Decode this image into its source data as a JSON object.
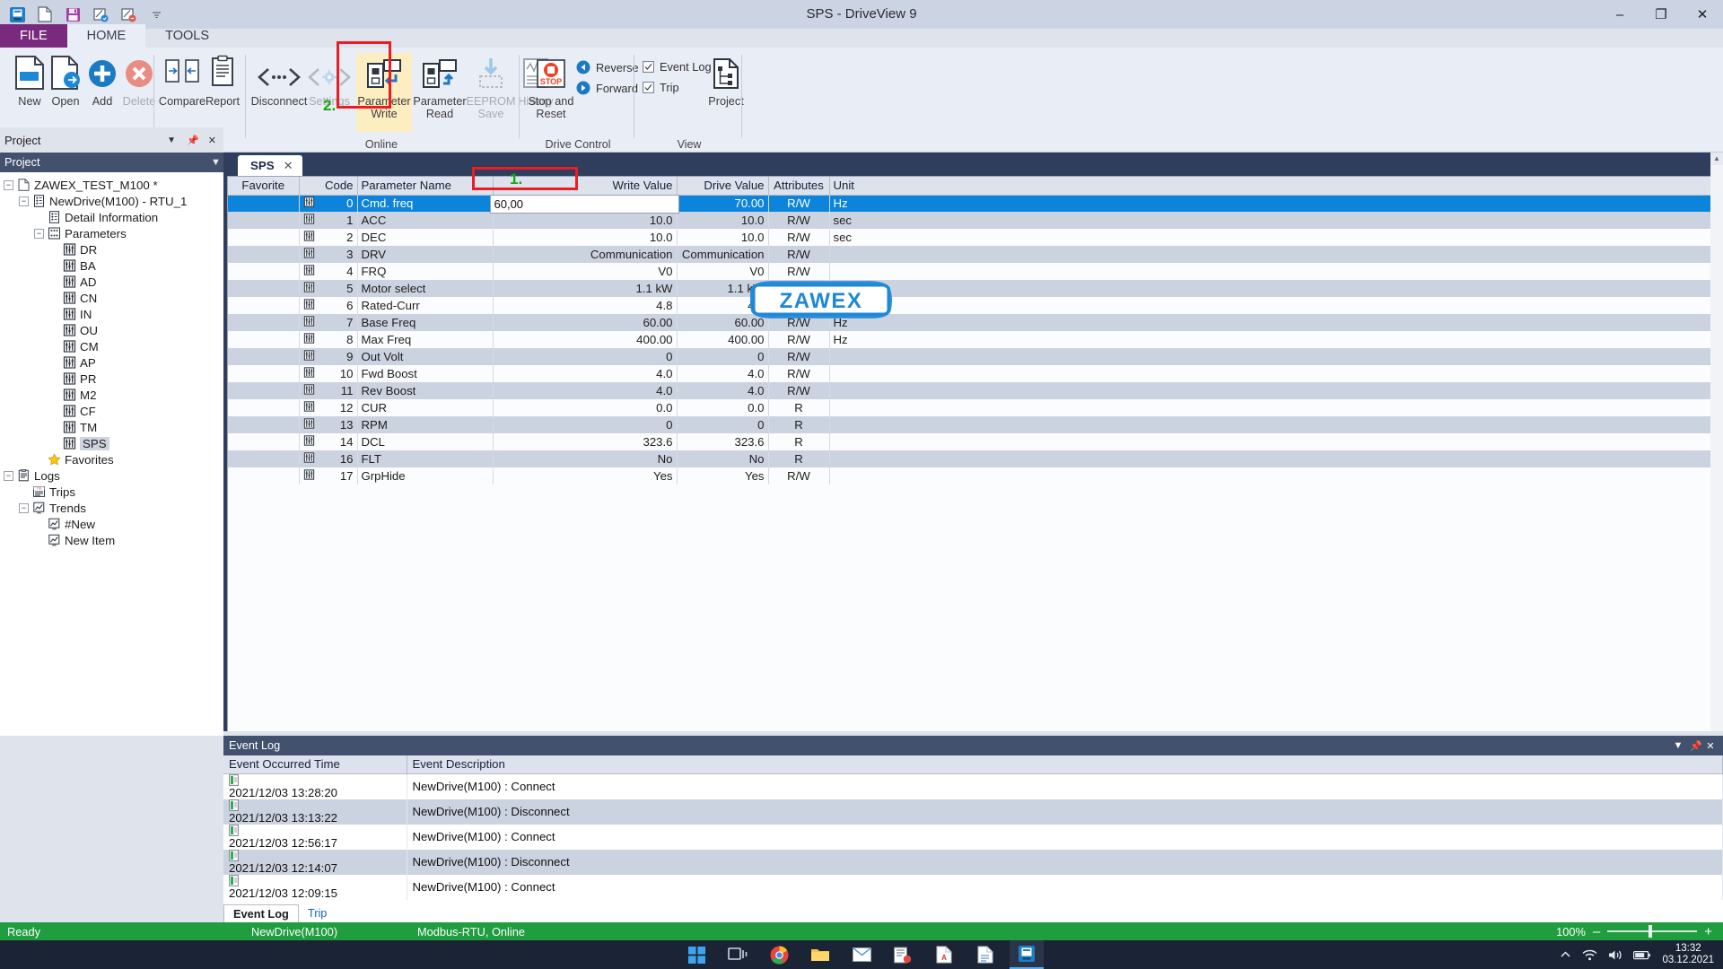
{
  "window": {
    "title": "SPS - DriveView 9",
    "minimize": "–",
    "maximize": "❐",
    "close": "✕"
  },
  "quick_access": [
    "app-icon",
    "new-icon",
    "save-icon",
    "param-write-icon",
    "param-read-icon",
    "more-icon"
  ],
  "tabs": [
    {
      "label": "FILE",
      "active": false
    },
    {
      "label": "HOME",
      "active": true
    },
    {
      "label": "TOOLS",
      "active": false
    }
  ],
  "ribbon": {
    "groups": [
      {
        "name": "Project",
        "label": "Project",
        "buttons": [
          {
            "label": "New",
            "disabled": false
          },
          {
            "label": "Open",
            "disabled": false
          },
          {
            "label": "Add",
            "disabled": false
          },
          {
            "label": "Delete",
            "disabled": true
          },
          {
            "label": "Compare",
            "disabled": false
          },
          {
            "label": "Report",
            "disabled": false
          }
        ]
      },
      {
        "name": "Online",
        "label": "Online",
        "buttons": [
          {
            "label": "Disconnect",
            "disabled": false
          },
          {
            "label": "Settings",
            "disabled": true
          },
          {
            "label": "Parameter\nWrite",
            "line1": "Parameter",
            "line2": "Write",
            "highlighted": true
          },
          {
            "label": "Parameter\nRead",
            "line1": "Parameter",
            "line2": "Read"
          },
          {
            "label": "EEPROM\nSave",
            "line1": "EEPROM",
            "line2": "Save",
            "disabled": true
          },
          {
            "label": "History",
            "disabled": true
          }
        ]
      },
      {
        "name": "Drive Control",
        "label": "Drive Control",
        "buttons": [
          {
            "label": "Stop and\nReset",
            "line1": "Stop and",
            "line2": "Reset"
          }
        ],
        "radios": [
          {
            "label": "Reverse",
            "selected": false
          },
          {
            "label": "Forward",
            "selected": false
          }
        ]
      },
      {
        "name": "View",
        "label": "View",
        "checkboxes": [
          {
            "label": "Event Log",
            "checked": true
          },
          {
            "label": "Trip",
            "checked": true
          }
        ],
        "buttons": [
          {
            "label": "Project"
          }
        ]
      }
    ]
  },
  "annotations": [
    {
      "id": "1",
      "text": "1.",
      "color": "#12a80f",
      "target": "write-value-cell"
    },
    {
      "id": "2",
      "text": "2.",
      "color": "#12a80f",
      "target": "parameter-write-button"
    }
  ],
  "watermark": {
    "text": "ZAWEX",
    "color": "#1e88d8"
  },
  "sidebar": {
    "title": "Project",
    "header": "Project",
    "pin_icon": "pin-icon",
    "close_icon": "close-icon",
    "collapse_icon": "chevron-down-icon",
    "tree": [
      {
        "label": "ZAWEX_TEST_M100 *",
        "depth": 0,
        "toggle": "-",
        "icon": "file-icon"
      },
      {
        "label": "NewDrive(M100) - RTU_1",
        "depth": 1,
        "toggle": "-",
        "icon": "drive-icon"
      },
      {
        "label": "Detail Information",
        "depth": 2,
        "toggle": "",
        "icon": "drive-icon"
      },
      {
        "label": "Parameters",
        "depth": 2,
        "toggle": "-",
        "icon": "params-icon"
      },
      {
        "label": "DR",
        "depth": 3,
        "toggle": "",
        "icon": "param-icon"
      },
      {
        "label": "BA",
        "depth": 3,
        "toggle": "",
        "icon": "param-icon"
      },
      {
        "label": "AD",
        "depth": 3,
        "toggle": "",
        "icon": "param-icon"
      },
      {
        "label": "CN",
        "depth": 3,
        "toggle": "",
        "icon": "param-icon"
      },
      {
        "label": "IN",
        "depth": 3,
        "toggle": "",
        "icon": "param-icon"
      },
      {
        "label": "OU",
        "depth": 3,
        "toggle": "",
        "icon": "param-icon"
      },
      {
        "label": "CM",
        "depth": 3,
        "toggle": "",
        "icon": "param-icon"
      },
      {
        "label": "AP",
        "depth": 3,
        "toggle": "",
        "icon": "param-icon"
      },
      {
        "label": "PR",
        "depth": 3,
        "toggle": "",
        "icon": "param-icon"
      },
      {
        "label": "M2",
        "depth": 3,
        "toggle": "",
        "icon": "param-icon"
      },
      {
        "label": "CF",
        "depth": 3,
        "toggle": "",
        "icon": "param-icon"
      },
      {
        "label": "TM",
        "depth": 3,
        "toggle": "",
        "icon": "param-icon"
      },
      {
        "label": "SPS",
        "depth": 3,
        "toggle": "",
        "icon": "param-icon",
        "selected": true
      },
      {
        "label": "Favorites",
        "depth": 2,
        "toggle": "",
        "icon": "star-icon"
      },
      {
        "label": "Logs",
        "depth": 0,
        "toggle": "-",
        "icon": "logs-icon"
      },
      {
        "label": "Trips",
        "depth": 1,
        "toggle": "",
        "icon": "trip-icon"
      },
      {
        "label": "Trends",
        "depth": 1,
        "toggle": "-",
        "icon": "trend-icon"
      },
      {
        "label": "#New",
        "depth": 2,
        "toggle": "",
        "icon": "trend-icon"
      },
      {
        "label": "New Item",
        "depth": 2,
        "toggle": "",
        "icon": "trend-icon"
      }
    ]
  },
  "document": {
    "tab_label": "SPS",
    "tab_close": "✕",
    "columns": [
      "Favorite",
      "Code",
      "Parameter Name",
      "Write Value",
      "Drive Value",
      "Attributes",
      "Unit"
    ],
    "editing": {
      "row_code": "0",
      "value": "60,00"
    },
    "rows": [
      {
        "code": "0",
        "name": "Cmd. freq",
        "write": "60,00",
        "drive": "70.00",
        "attr": "R/W",
        "unit": "Hz",
        "selected": true
      },
      {
        "code": "1",
        "name": "ACC",
        "write": "10.0",
        "drive": "10.0",
        "attr": "R/W",
        "unit": "sec"
      },
      {
        "code": "2",
        "name": "DEC",
        "write": "10.0",
        "drive": "10.0",
        "attr": "R/W",
        "unit": "sec"
      },
      {
        "code": "3",
        "name": "DRV",
        "write": "Communication",
        "drive": "Communication",
        "attr": "R/W",
        "unit": ""
      },
      {
        "code": "4",
        "name": "FRQ",
        "write": "V0",
        "drive": "V0",
        "attr": "R/W",
        "unit": ""
      },
      {
        "code": "5",
        "name": "Motor select",
        "write": "1.1 kW",
        "drive": "1.1 kW",
        "attr": "R/W",
        "unit": ""
      },
      {
        "code": "6",
        "name": "Rated-Curr",
        "write": "4.8",
        "drive": "4.8",
        "attr": "R/W",
        "unit": ""
      },
      {
        "code": "7",
        "name": "Base Freq",
        "write": "60.00",
        "drive": "60.00",
        "attr": "R/W",
        "unit": "Hz"
      },
      {
        "code": "8",
        "name": "Max Freq",
        "write": "400.00",
        "drive": "400.00",
        "attr": "R/W",
        "unit": "Hz"
      },
      {
        "code": "9",
        "name": "Out Volt",
        "write": "0",
        "drive": "0",
        "attr": "R/W",
        "unit": ""
      },
      {
        "code": "10",
        "name": "Fwd Boost",
        "write": "4.0",
        "drive": "4.0",
        "attr": "R/W",
        "unit": ""
      },
      {
        "code": "11",
        "name": "Rev Boost",
        "write": "4.0",
        "drive": "4.0",
        "attr": "R/W",
        "unit": ""
      },
      {
        "code": "12",
        "name": "CUR",
        "write": "0.0",
        "drive": "0.0",
        "attr": "R",
        "unit": ""
      },
      {
        "code": "13",
        "name": "RPM",
        "write": "0",
        "drive": "0",
        "attr": "R",
        "unit": ""
      },
      {
        "code": "14",
        "name": "DCL",
        "write": "323.6",
        "drive": "323.6",
        "attr": "R",
        "unit": ""
      },
      {
        "code": "16",
        "name": "FLT",
        "write": "No",
        "drive": "No",
        "attr": "R",
        "unit": ""
      },
      {
        "code": "17",
        "name": "GrpHide",
        "write": "Yes",
        "drive": "Yes",
        "attr": "R/W",
        "unit": ""
      }
    ]
  },
  "event_log": {
    "title": "Event Log",
    "collapse_icon": "chevron-down-icon",
    "pin_icon": "pin-icon",
    "close_icon": "close-icon",
    "columns": [
      "Event Occurred Time",
      "Event Description"
    ],
    "rows": [
      {
        "time": "2021/12/03 13:28:20",
        "desc": "NewDrive(M100) : Connect"
      },
      {
        "time": "2021/12/03 13:13:22",
        "desc": "NewDrive(M100) : Disconnect"
      },
      {
        "time": "2021/12/03 12:56:17",
        "desc": "NewDrive(M100) : Connect"
      },
      {
        "time": "2021/12/03 12:14:07",
        "desc": "NewDrive(M100) : Disconnect"
      },
      {
        "time": "2021/12/03 12:09:15",
        "desc": "NewDrive(M100) : Connect"
      }
    ],
    "tabs": [
      {
        "label": "Event Log",
        "active": true
      },
      {
        "label": "Trip",
        "active": false
      }
    ]
  },
  "status_bar": {
    "state": "Ready",
    "device": "NewDrive(M100)",
    "connection": "Modbus-RTU, Online",
    "zoom": "100%",
    "zoom_out": "–",
    "zoom_in": "+"
  },
  "taskbar": {
    "items": [
      "start-icon",
      "taskview-icon",
      "chrome-icon",
      "explorer-icon",
      "mail-icon",
      "app2-icon",
      "pdf-icon",
      "doc-icon",
      "driveview-icon"
    ],
    "tray": [
      "chevron-up-icon",
      "wifi-icon",
      "volume-icon",
      "battery-icon"
    ],
    "clock_time": "13:32",
    "clock_date": "03.12.2021"
  }
}
